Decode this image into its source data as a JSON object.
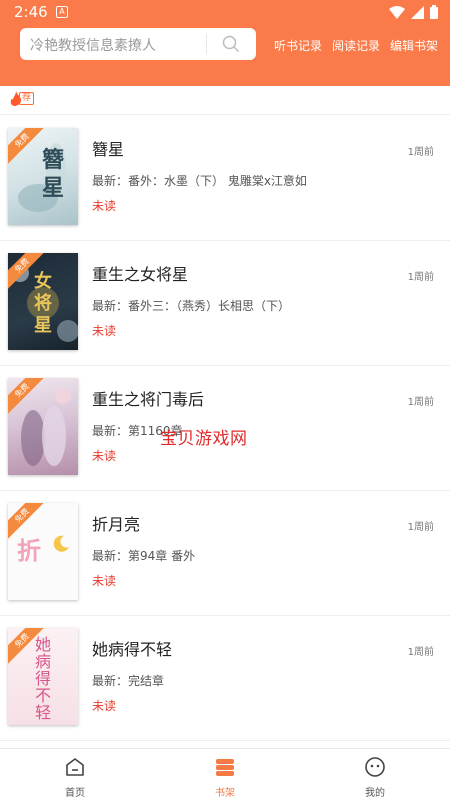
{
  "status": {
    "time": "2:46",
    "notif": "A"
  },
  "search": {
    "placeholder": "冷艳教授信息素撩人"
  },
  "top_links": [
    "听书记录",
    "阅读记录",
    "编辑书架"
  ],
  "recommend_label": "荐",
  "free_tag": "免费",
  "books": [
    {
      "title": "簪星",
      "latest": "最新：番外：水墨（下） 鬼雕棠x江意如",
      "status": "未读",
      "time": "1周前",
      "cover_text": "簪星",
      "has_free_tag": true
    },
    {
      "title": "重生之女将星",
      "latest": "最新：番外三：（燕秀）长相思（下）",
      "status": "未读",
      "time": "1周前",
      "cover_text": "女将星",
      "has_free_tag": true
    },
    {
      "title": "重生之将门毒后",
      "latest": "最新：第1160章",
      "status": "未读",
      "time": "1周前",
      "cover_text": "",
      "has_free_tag": true
    },
    {
      "title": "折月亮",
      "latest": "最新：第94章 番外",
      "status": "未读",
      "time": "1周前",
      "cover_text": "折",
      "has_free_tag": true
    },
    {
      "title": "她病得不轻",
      "latest": "最新：完结章",
      "status": "未读",
      "time": "1周前",
      "cover_text": "她病得不轻",
      "has_free_tag": true
    }
  ],
  "watermark": "宝贝游戏网",
  "tabs": [
    {
      "label": "首页",
      "active": false
    },
    {
      "label": "书架",
      "active": true
    },
    {
      "label": "我的",
      "active": false
    }
  ],
  "colors": {
    "accent": "#fa7b49",
    "unread": "#e83a2a",
    "tab_active": "#f47a46"
  }
}
